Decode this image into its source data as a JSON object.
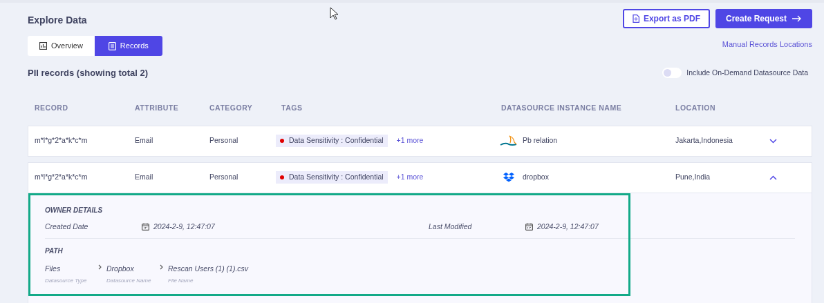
{
  "title": "Explore Data",
  "actions": [
    {
      "kind": "outline",
      "label": "Export as PDF"
    },
    {
      "kind": "primary",
      "label": "Create Request"
    }
  ],
  "tabs": [
    {
      "label": "Overview",
      "kind": "chart",
      "selected": false
    },
    {
      "label": "Records",
      "kind": "list",
      "selected": true
    }
  ],
  "link": "Manual Records Locations",
  "heading": "PII records (showing total 2)",
  "toggle": {
    "label": "Include On-Demand Datasource Data",
    "on": false
  },
  "table": {
    "columns": [
      "RECORD",
      "ATTRIBUTE",
      "CATEGORY",
      "TAGS",
      "DATASOURCE INSTANCE NAME",
      "LOCATION"
    ],
    "rows": [
      {
        "record": "m*l*g*2*a*k*c*m",
        "attribute": "Email",
        "category": "Personal",
        "tag": {
          "text": "Data Sensitivity : Confidential",
          "color": "#e00000"
        },
        "more": "+1 more",
        "kind": "mysql",
        "datasource": "Pb relation",
        "location": "Jakarta,Indonesia",
        "expanded": false
      },
      {
        "record": "m*l*g*2*a*k*c*m",
        "attribute": "Email",
        "category": "Personal",
        "tag": {
          "text": "Data Sensitivity : Confidential",
          "color": "#e00000"
        },
        "more": "+1 more",
        "kind": "dropbox",
        "datasource": "dropbox",
        "location": "Pune,India",
        "expanded": true,
        "details": {
          "owner_heading": "OWNER DETAILS",
          "dates": [
            {
              "label": "Created Date",
              "value": "2024-2-9, 12:47:07"
            },
            {
              "label": "Last Modified",
              "value": "2024-2-9, 12:47:07"
            }
          ],
          "path_heading": "PATH",
          "path": [
            {
              "value": "Files",
              "caption": "Datasource Type"
            },
            {
              "value": "Dropbox",
              "caption": "Datasource Name"
            },
            {
              "value": "Rescan Users (1) (1).csv",
              "caption": "File Name"
            }
          ]
        }
      }
    ]
  },
  "highlight": true
}
